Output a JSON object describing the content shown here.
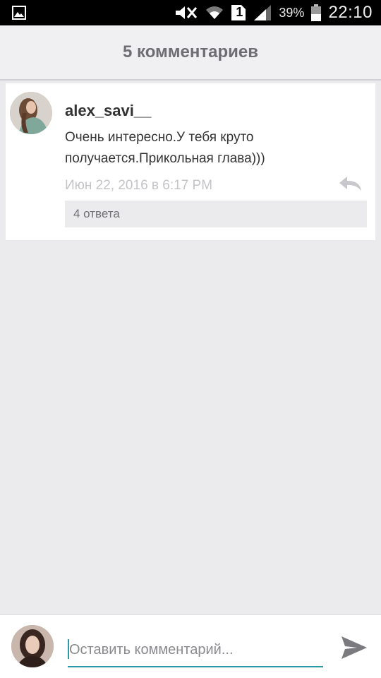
{
  "status_bar": {
    "battery_percent": "39%",
    "time": "22:10",
    "sim_slot": "1",
    "icons": [
      "gallery-icon",
      "mute-icon",
      "wifi-icon",
      "sim-icon",
      "signal-icon",
      "battery-icon"
    ]
  },
  "header": {
    "title": "5 комментариев"
  },
  "comment": {
    "author": "alex_savi__",
    "text": "Очень интересно.У тебя круто получается.Прикольная глава)))",
    "timestamp": "Июн 22, 2016 в 6:17 PM",
    "replies_label": "4 ответа",
    "reply_icon": "reply-icon"
  },
  "composer": {
    "placeholder": "Оставить комментарий...",
    "value": "",
    "send_icon": "send-icon"
  },
  "colors": {
    "accent": "#2a9ba8",
    "background": "#ebebee",
    "header_text": "#6e6e72",
    "timestamp": "#c4c4c8"
  }
}
